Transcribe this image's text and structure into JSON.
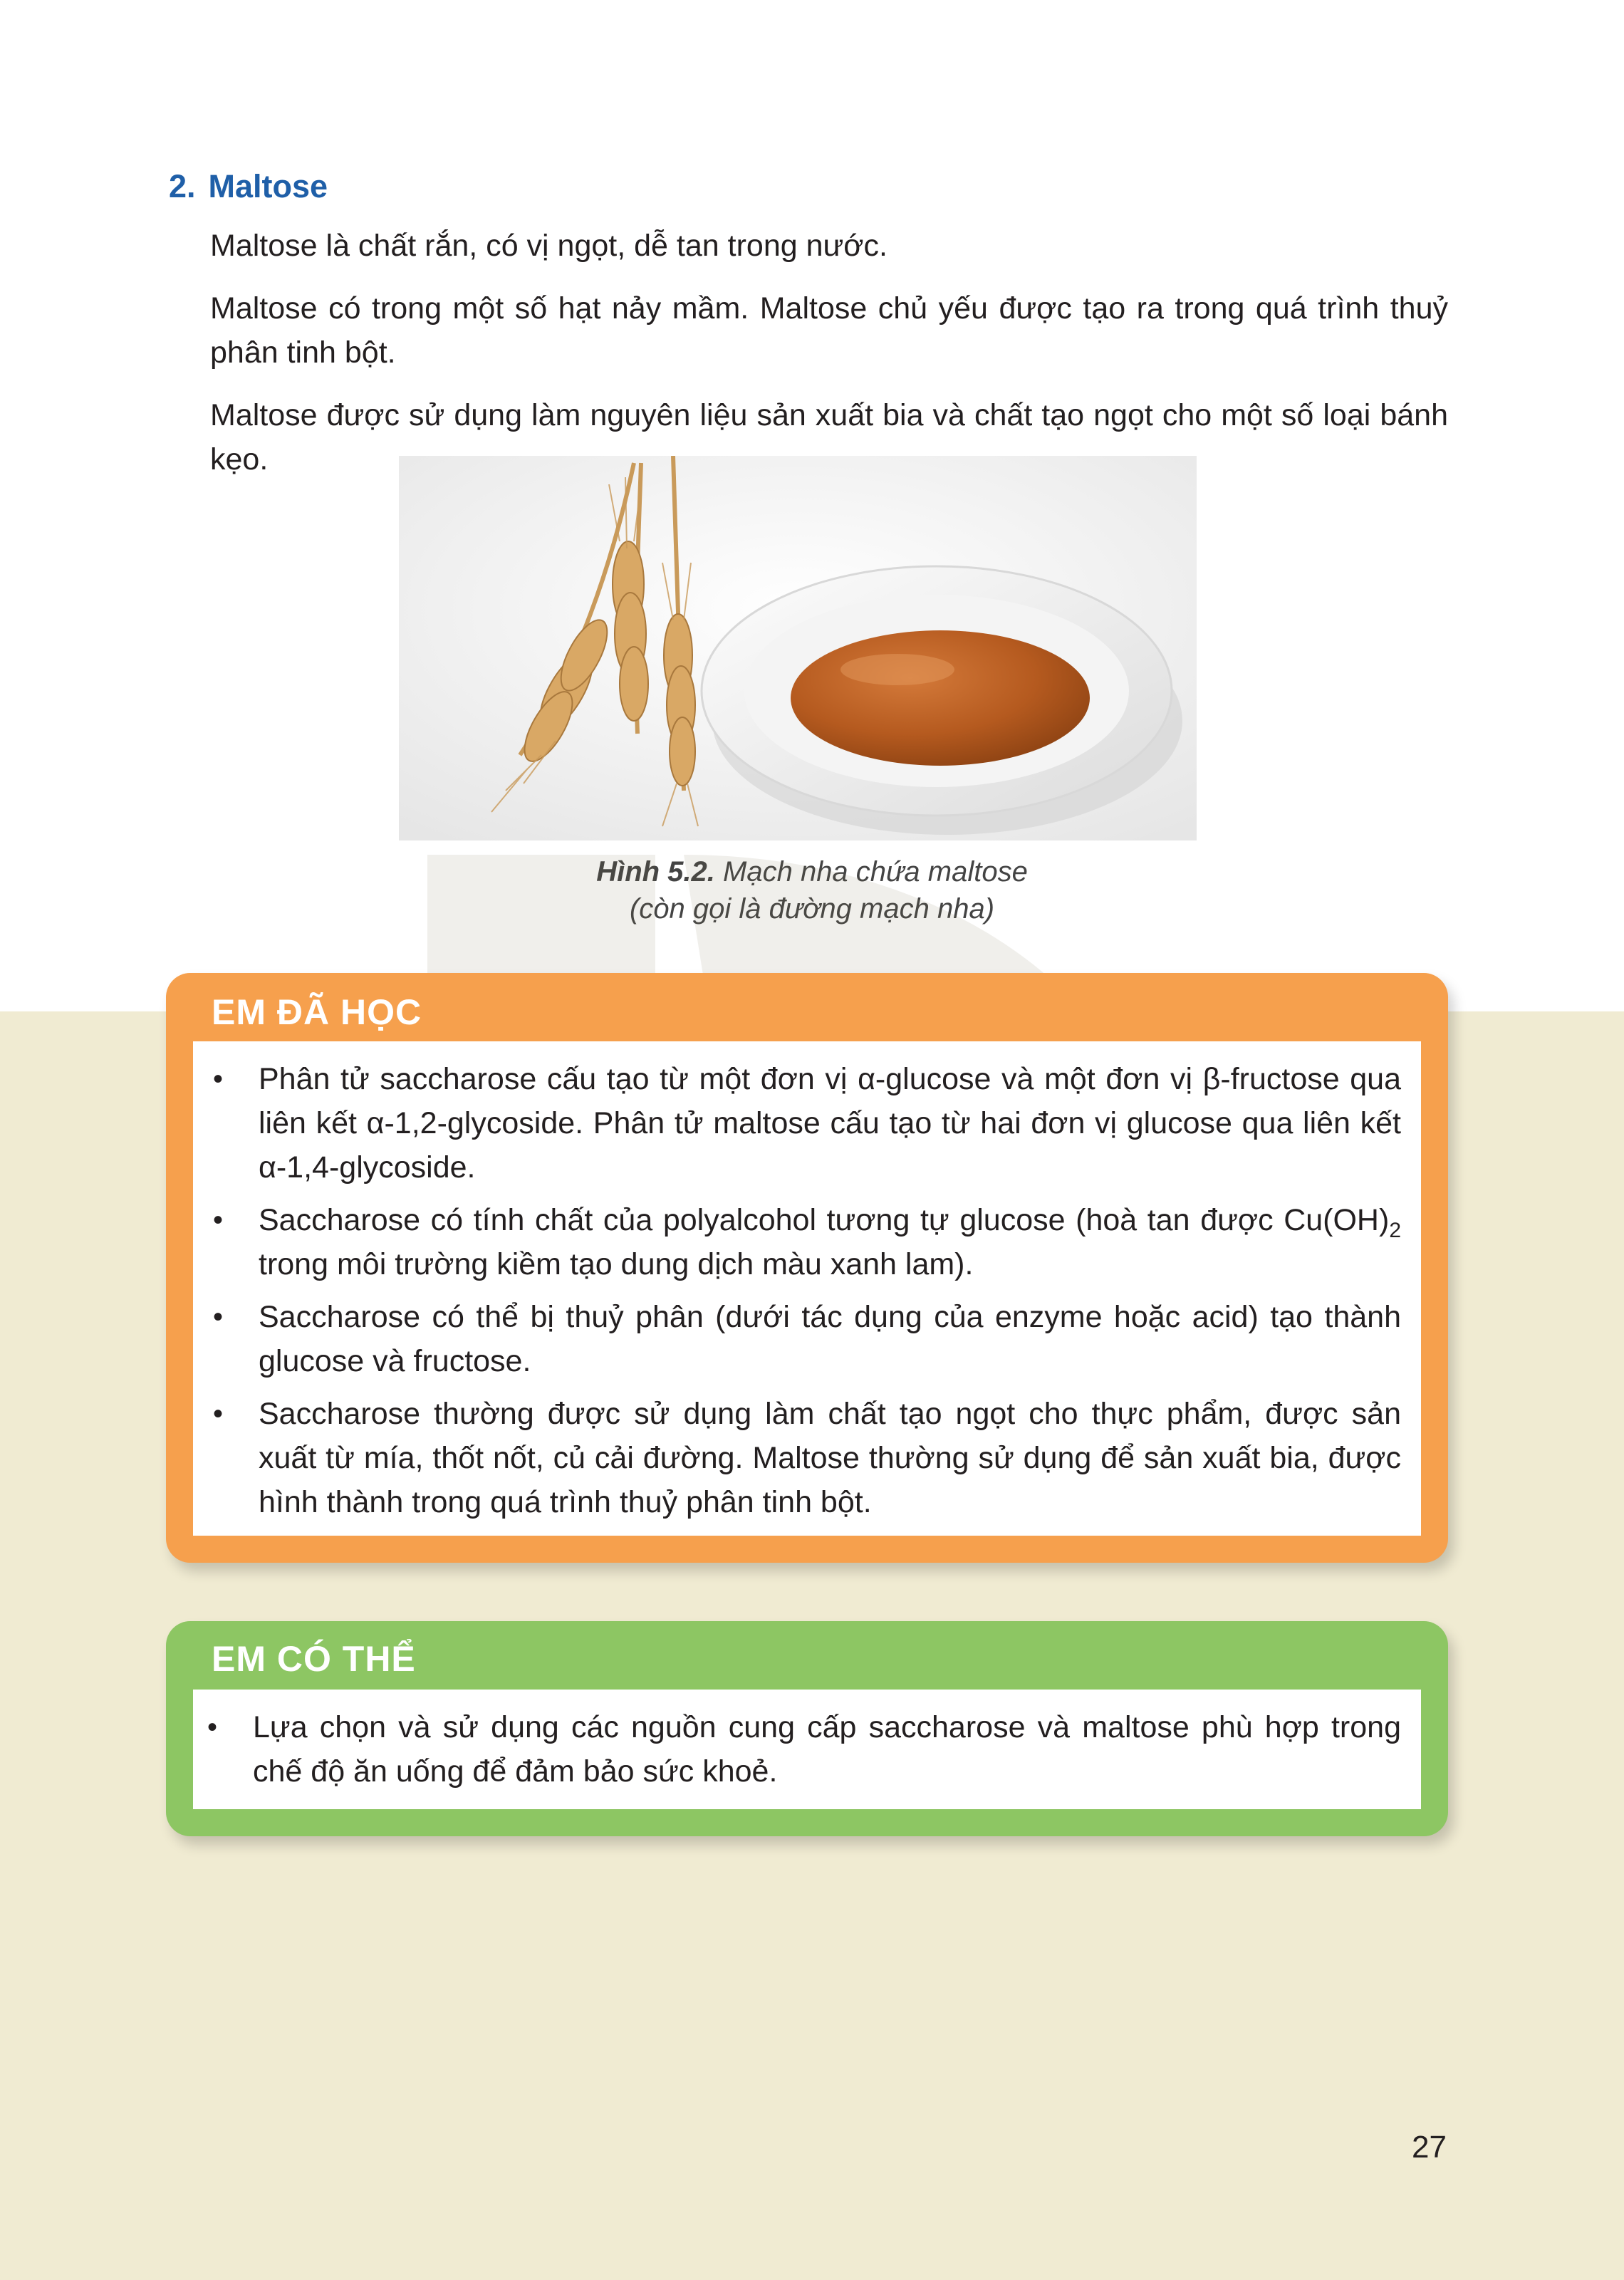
{
  "section": {
    "number": "2.",
    "title": "Maltose"
  },
  "paragraphs": [
    "Maltose là chất rắn, có vị ngọt, dễ tan trong nước.",
    "Maltose có trong một số hạt nảy mầm. Maltose chủ yếu được tạo ra trong quá trình thuỷ phân tinh bột.",
    "Maltose được sử dụng làm nguyên liệu sản xuất bia và chất tạo ngọt cho một số loại bánh kẹo."
  ],
  "figure": {
    "label": "Hình 5.2.",
    "caption_line1": "Mạch nha chứa maltose",
    "caption_line2": "(còn gọi là đường mạch nha)"
  },
  "box_learned": {
    "heading": "EM ĐÃ HỌC",
    "items": {
      "item1_a": "Phân tử saccharose cấu tạo từ một đơn vị α-glucose và một đơn vị β-fructose qua liên kết α-1,2-glycoside. Phân tử maltose cấu tạo từ hai đơn vị glucose qua liên kết α-1,4-glycoside.",
      "item2_a": "Saccharose có tính chất của polyalcohol tương tự glucose (hoà tan được Cu(OH)",
      "item2_sub": "2",
      "item2_b": " trong môi trường kiềm tạo dung dịch màu xanh lam).",
      "item3": "Saccharose có thể bị thuỷ phân (dưới tác dụng của enzyme hoặc acid) tạo thành glucose và fructose.",
      "item4": "Saccharose thường được sử dụng làm chất tạo ngọt cho thực phẩm, được sản xuất từ mía, thốt nốt, củ cải đường. Maltose thường sử dụng để sản xuất bia, được hình thành trong quá trình thuỷ phân tinh bột."
    }
  },
  "box_can": {
    "heading": "EM CÓ THỂ",
    "item1": "Lựa chọn và sử dụng các nguồn cung cấp saccharose và maltose phù hợp trong chế độ ăn uống để đảm bảo sức khoẻ."
  },
  "bullet_char": "•",
  "page_number": "27",
  "colors": {
    "title_blue": "#1f5fa8",
    "orange_box": "#f6a04d",
    "green_box": "#8dc663",
    "cream_background": "#f0ebd2"
  }
}
